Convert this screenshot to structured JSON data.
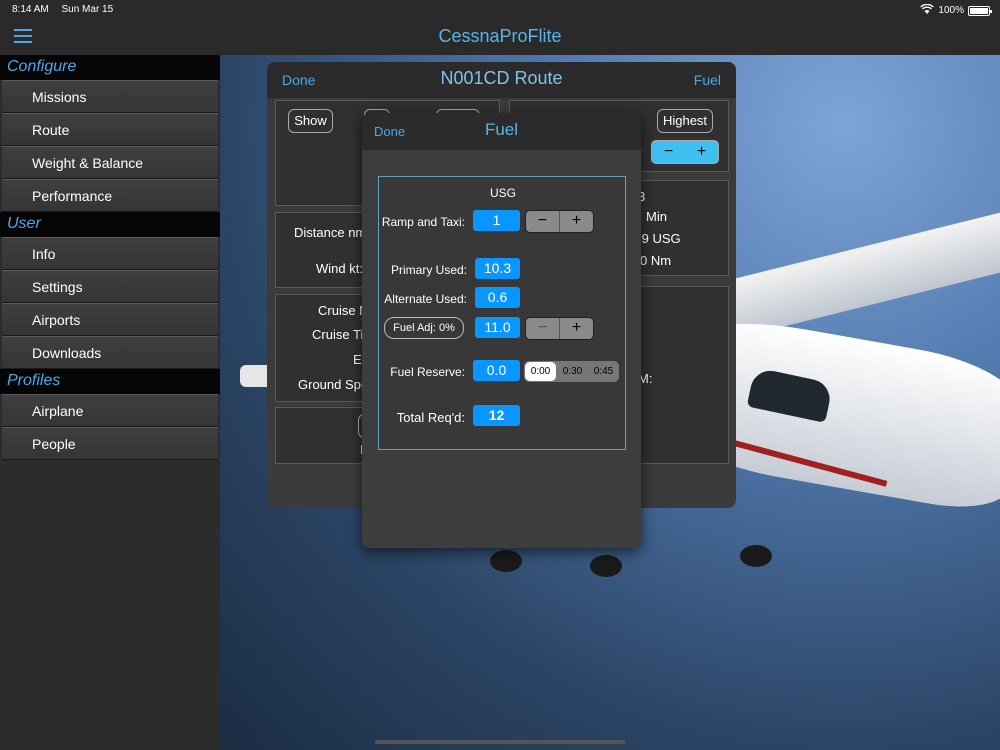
{
  "status": {
    "time": "8:14 AM",
    "date": "Sun Mar 15",
    "battery": "100%"
  },
  "app": {
    "title": "CessnaProFlite"
  },
  "sidebar": {
    "sections": [
      {
        "header": "Configure",
        "items": [
          "Missions",
          "Route",
          "Weight & Balance",
          "Performance"
        ]
      },
      {
        "header": "User",
        "items": [
          "Info",
          "Settings",
          "Airports",
          "Downloads"
        ]
      },
      {
        "header": "Profiles",
        "items": [
          "Airplane",
          "People"
        ]
      }
    ]
  },
  "route": {
    "done": "Done",
    "title": "N001CD  Route",
    "fuel": "Fuel",
    "show": "Show",
    "highest": "Highest",
    "minus": "−",
    "plus": "+",
    "distance_label": "Distance nm:",
    "wind_label": "Wind kt:",
    "cruise_n": "Cruise N",
    "cruise_tim": "Cruise Tim",
    "et": "ET",
    "ground_spee": "Ground Spee",
    "right_3": "3",
    "right_min": "Min",
    "right_usg": ".9  USG",
    "right_nm": "0  Nm",
    "right_m": "M:",
    "left_i": "I"
  },
  "fuel": {
    "done": "Done",
    "title": "Fuel",
    "unit": "USG",
    "ramp_label": "Ramp and Taxi:",
    "ramp_value": "1",
    "primary_label": "Primary Used:",
    "primary_value": "10.3",
    "alternate_label": "Alternate Used:",
    "alternate_value": "0.6",
    "adj_label": "Fuel Adj:  0%",
    "adj_value": "11.0",
    "reserve_label": "Fuel Reserve:",
    "reserve_value": "0.0",
    "reserve_options": [
      "0:00",
      "0:30",
      "0:45"
    ],
    "total_label": "Total Req'd:",
    "total_value": "12",
    "minus": "−",
    "plus": "+"
  }
}
